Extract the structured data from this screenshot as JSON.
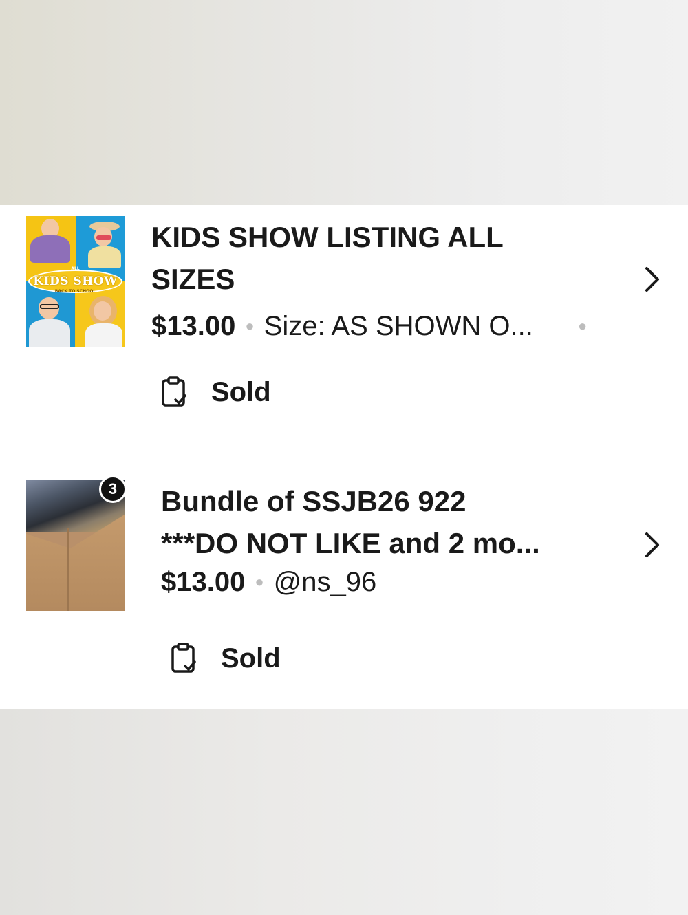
{
  "listings": [
    {
      "title_line1": "KIDS SHOW LISTING ALL",
      "title_line2": "SIZES",
      "price": "$13.00",
      "detail": "Size: AS SHOWN O...",
      "status": "Sold",
      "thumbnail_text": {
        "top": "ALL",
        "main": "KIDS SHOW",
        "sub": "BACK TO SCHOOL"
      },
      "status_icon": "clipboard-check-icon",
      "chevron_icon": "chevron-right-icon"
    },
    {
      "title_line1": "Bundle of SSJB26 922",
      "title_line2": "***DO NOT LIKE and 2 mo...",
      "price": "$13.00",
      "detail": "@ns_96",
      "status": "Sold",
      "badge_count": "3",
      "status_icon": "clipboard-check-icon",
      "chevron_icon": "chevron-right-icon"
    }
  ],
  "colors": {
    "text": "#1a1a1a",
    "separator": "#bdbdbd",
    "badge": "#111111",
    "card": "#ffffff"
  }
}
